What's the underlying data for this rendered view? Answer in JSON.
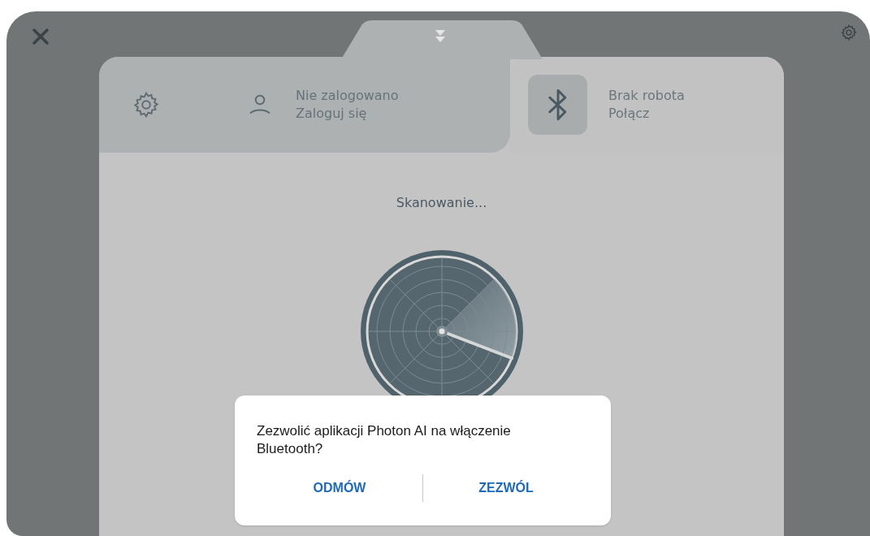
{
  "tabs": [
    {
      "kind": "settings",
      "selected": false
    },
    {
      "kind": "account",
      "title": "Nie zalogowano",
      "subtitle": "Zaloguj się",
      "selected": false
    },
    {
      "kind": "robot",
      "title": "Brak robota",
      "subtitle": "Połącz",
      "selected": true
    }
  ],
  "status": "Skanowanie...",
  "dialog": {
    "message": "Zezwolić aplikacji Photon AI na włączenie Bluetooth?",
    "buttons": [
      "ODMÓW",
      "ZEZWÓL"
    ]
  }
}
